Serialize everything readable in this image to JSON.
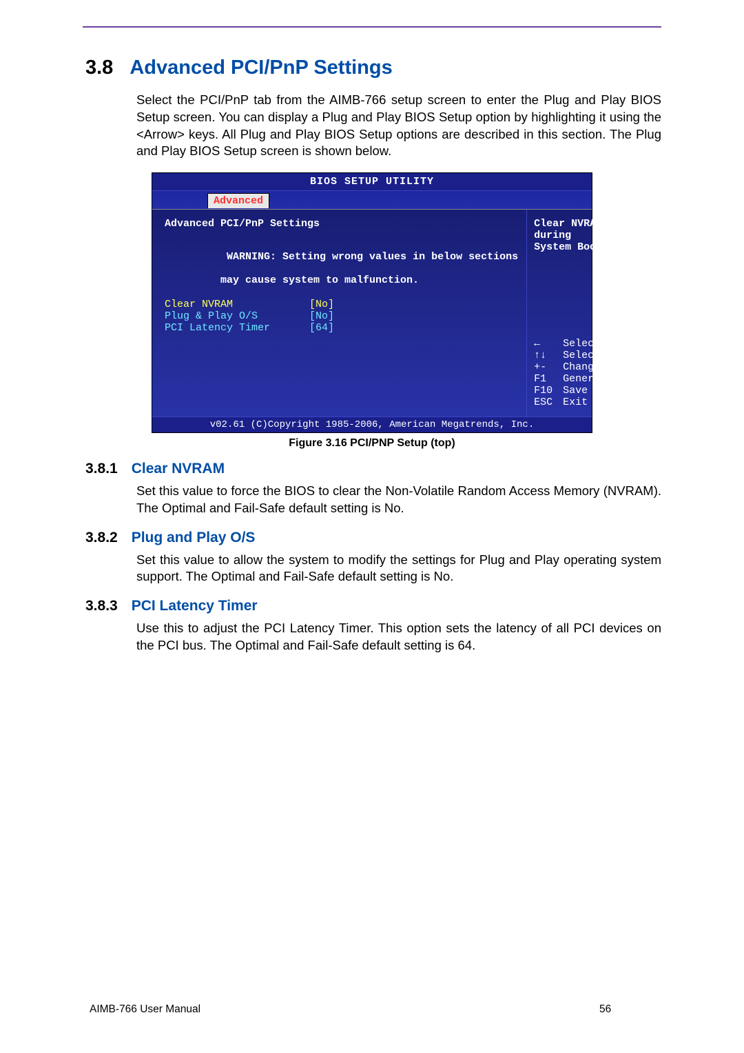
{
  "section": {
    "num": "3.8",
    "title": "Advanced PCI/PnP Settings",
    "intro": "Select the PCI/PnP tab from the AIMB-766 setup screen to enter the Plug and Play BIOS Setup screen. You can display a Plug and Play BIOS Setup option by highlighting it using the <Arrow> keys. All Plug and Play BIOS Setup options are described in this section. The Plug and Play BIOS Setup screen is shown below."
  },
  "bios": {
    "title": "BIOS SETUP UTILITY",
    "tab": "Advanced",
    "panel_title": "Advanced PCI/PnP Settings",
    "warning_label": "WARNING:",
    "warning_l1": " Setting wrong values in below sections",
    "warning_l2": "         may cause system to malfunction.",
    "options": [
      {
        "label": "Clear NVRAM",
        "value": "[No]"
      },
      {
        "label": "Plug & Play O/S",
        "value": "[No]"
      },
      {
        "label": "PCI Latency Timer",
        "value": "[64]"
      }
    ],
    "help_text_l1": "Clear NVRAM during",
    "help_text_l2": "System Boot.",
    "nav": [
      {
        "key": "←",
        "action": "Select Screen"
      },
      {
        "key": "↑↓",
        "action": "Select Item"
      },
      {
        "key": "+-",
        "action": "Change Option"
      },
      {
        "key": "F1",
        "action": "General Help"
      },
      {
        "key": "F10",
        "action": "Save and Exit"
      },
      {
        "key": "ESC",
        "action": "Exit"
      }
    ],
    "footer": "v02.61 (C)Copyright 1985-2006, American Megatrends, Inc."
  },
  "figure_caption": "Figure 3.16 PCI/PNP Setup (top)",
  "subsections": [
    {
      "num": "3.8.1",
      "title": "Clear NVRAM",
      "text": "Set this value to force the BIOS to clear the Non-Volatile Random Access Memory (NVRAM). The Optimal and Fail-Safe default setting is No."
    },
    {
      "num": "3.8.2",
      "title": "Plug and Play O/S",
      "text": "Set this value to allow the system to modify the settings for Plug and Play operating system support. The Optimal and Fail-Safe default setting is No."
    },
    {
      "num": "3.8.3",
      "title": "PCI Latency Timer",
      "text": "Use this to adjust the PCI Latency Timer. This option sets the latency of all PCI devices on the PCI bus. The Optimal and Fail-Safe default setting is 64."
    }
  ],
  "footer": {
    "manual": "AIMB-766 User Manual",
    "page": "56"
  }
}
